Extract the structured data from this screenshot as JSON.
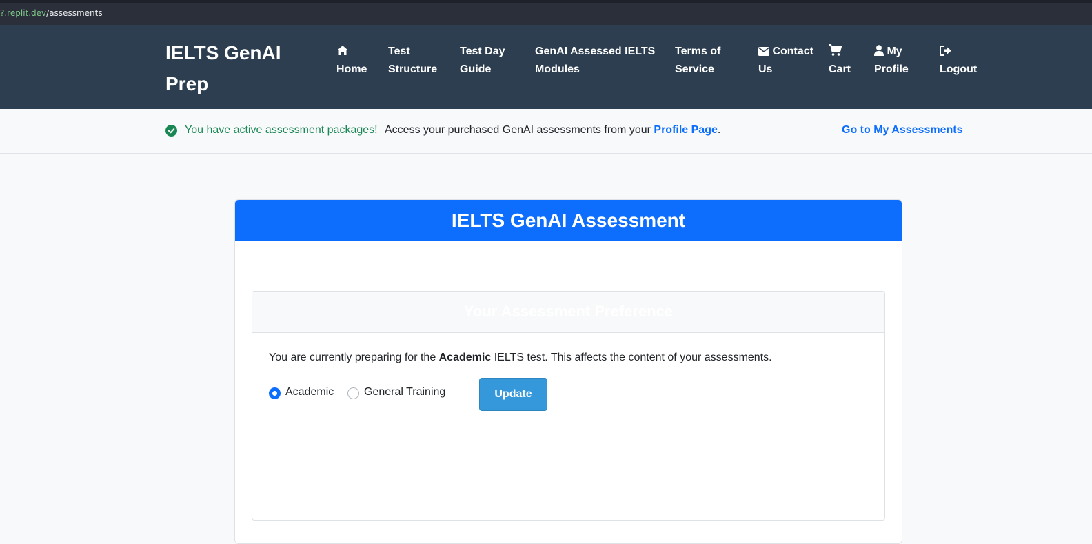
{
  "browser": {
    "url_host": "?.replit.dev",
    "url_path": "/assessments"
  },
  "navbar": {
    "brand": "IELTS GenAI Prep",
    "items": [
      {
        "line1": "Home",
        "line2": "",
        "icon": "home-icon"
      },
      {
        "line1": "Test",
        "line2": "Structure",
        "icon": ""
      },
      {
        "line1": "Test Day",
        "line2": "Guide",
        "icon": ""
      },
      {
        "line1": "GenAI Assessed IELTS",
        "line2": "Modules",
        "icon": ""
      },
      {
        "line1": "Terms of",
        "line2": "Service",
        "icon": ""
      },
      {
        "line1": "Contact",
        "line2": "Us",
        "icon": "envelope-icon"
      },
      {
        "line1": "",
        "line2": "Cart",
        "icon": "cart-icon"
      },
      {
        "line1": "My",
        "line2": "Profile",
        "icon": "user-icon"
      },
      {
        "line1": "",
        "line2": "Logout",
        "icon": "logout-icon"
      }
    ]
  },
  "alert": {
    "strong": "You have active assessment packages!",
    "text": "Access your purchased GenAI assessments from your",
    "link": "Profile Page",
    "period": ".",
    "action": "Go to My Assessments"
  },
  "card": {
    "title": "IELTS GenAI Assessment",
    "preference": {
      "title": "Your Assessment Preference",
      "text_before": "You are currently preparing for the",
      "test_type": "Academic",
      "text_after": "IELTS test. This affects the content of your assessments.",
      "options": [
        "Academic",
        "General Training"
      ],
      "selected": "Academic",
      "update_label": "Update"
    }
  },
  "colors": {
    "navbar": "#2c3e50",
    "primary": "#0d6efd",
    "success": "#198754",
    "button": "#3498db"
  }
}
